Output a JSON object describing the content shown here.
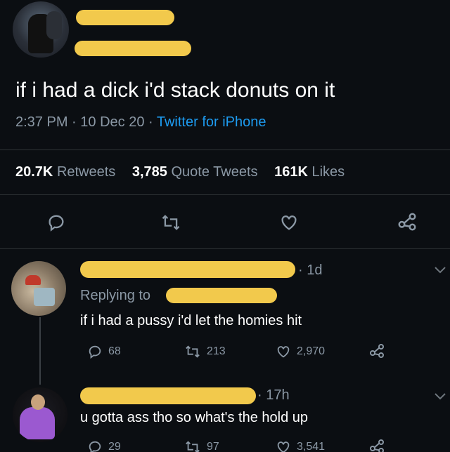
{
  "tweet": {
    "text": "if i had a dick i'd stack donuts on it",
    "time": "2:37 PM",
    "date": "10 Dec 20",
    "source": "Twitter for iPhone",
    "stats": {
      "retweets_count": "20.7K",
      "retweets_label": "Retweets",
      "quotes_count": "3,785",
      "quotes_label": "Quote Tweets",
      "likes_count": "161K",
      "likes_label": "Likes"
    }
  },
  "replies": [
    {
      "time": "· 1d",
      "replying_label": "Replying to",
      "text": "if i had a pussy i'd let the homies hit",
      "replies": "68",
      "retweets": "213",
      "likes": "2,970"
    },
    {
      "time": "· 17h",
      "text": "u gotta ass tho so what's the hold up",
      "replies": "29",
      "retweets": "97",
      "likes": "3,541"
    }
  ],
  "colors": {
    "background": "#0b0e12",
    "accent": "#1d9bf0",
    "redaction": "#f2c94c",
    "muted": "#8b98a5"
  },
  "icons": [
    "reply-icon",
    "retweet-icon",
    "like-icon",
    "share-icon",
    "chevron-down-icon"
  ]
}
